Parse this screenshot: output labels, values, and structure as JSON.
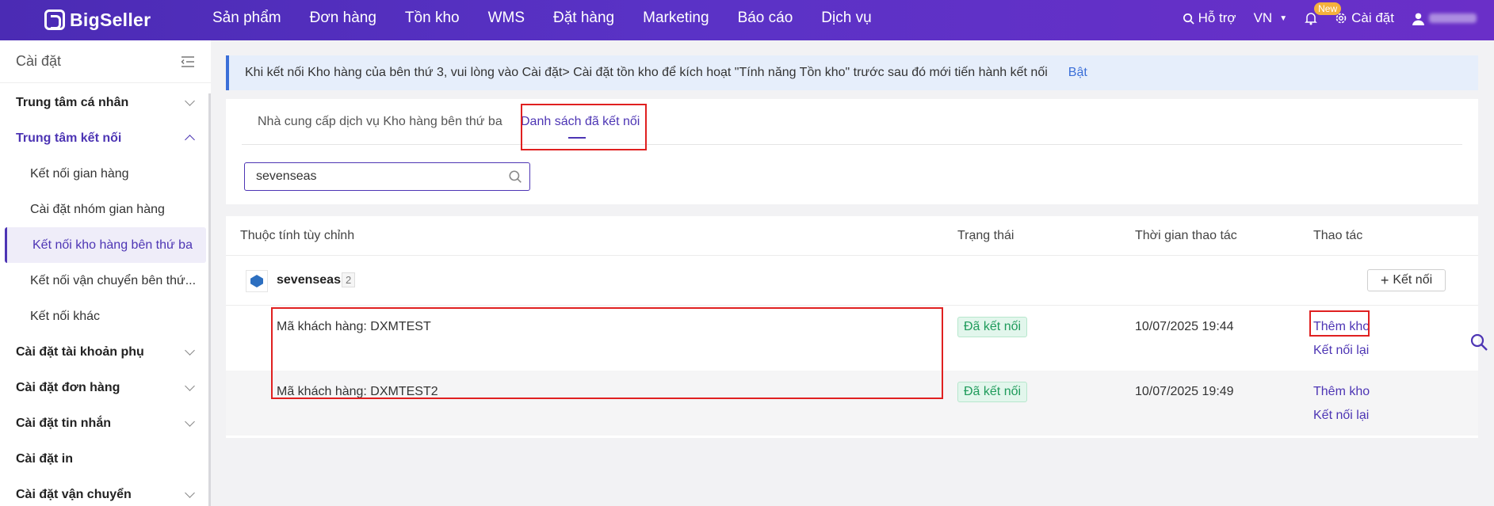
{
  "brand": {
    "name": "BigSeller"
  },
  "nav": [
    "Sản phẩm",
    "Đơn hàng",
    "Tồn kho",
    "WMS",
    "Đặt hàng",
    "Marketing",
    "Báo cáo",
    "Dịch vụ"
  ],
  "topright": {
    "support": "Hỗ trợ",
    "language": "VN",
    "new_badge": "New",
    "settings": "Cài đặt"
  },
  "sidebar": {
    "title": "Cài đặt",
    "groups": [
      {
        "label": "Trung tâm cá nhân"
      },
      {
        "label": "Trung tâm kết nối"
      },
      {
        "label": "Cài đặt tài khoản phụ"
      },
      {
        "label": "Cài đặt đơn hàng"
      },
      {
        "label": "Cài đặt tin nhắn"
      },
      {
        "label": "Cài đặt in"
      },
      {
        "label": "Cài đặt vận chuyển"
      }
    ],
    "sub_items": [
      {
        "label": "Kết nối gian hàng"
      },
      {
        "label": "Cài đặt nhóm gian hàng"
      },
      {
        "label": "Kết nối kho hàng bên thứ ba"
      },
      {
        "label": "Kết nối vận chuyển bên thứ..."
      },
      {
        "label": "Kết nối khác"
      }
    ]
  },
  "notice": {
    "text": "Khi kết nối Kho hàng của bên thứ 3, vui lòng vào Cài đặt> Cài đặt tồn kho để kích hoạt \"Tính năng Tồn kho\" trước sau đó mới tiến hành kết nối",
    "link": "Bật"
  },
  "tabs": [
    {
      "label": "Nhà cung cấp dịch vụ Kho hàng bên thứ ba"
    },
    {
      "label": "Danh sách đã kết nối"
    }
  ],
  "search": {
    "value": "sevenseas"
  },
  "table": {
    "headers": [
      "Thuộc tính tùy chỉnh",
      "Trạng thái",
      "Thời gian thao tác",
      "Thao tác"
    ],
    "group": {
      "name": "sevenseas",
      "count": "2",
      "connect_label": "Kết nối"
    },
    "rows": [
      {
        "name": "Mã khách hàng: DXMTEST",
        "status": "Đã kết nối",
        "time": "10/07/2025 19:44",
        "action1": "Thêm kho",
        "action2": "Kết nối lại"
      },
      {
        "name": "Mã khách hàng: DXMTEST2",
        "status": "Đã kết nối",
        "time": "10/07/2025 19:49",
        "action1": "Thêm kho",
        "action2": "Kết nối lại"
      }
    ]
  }
}
